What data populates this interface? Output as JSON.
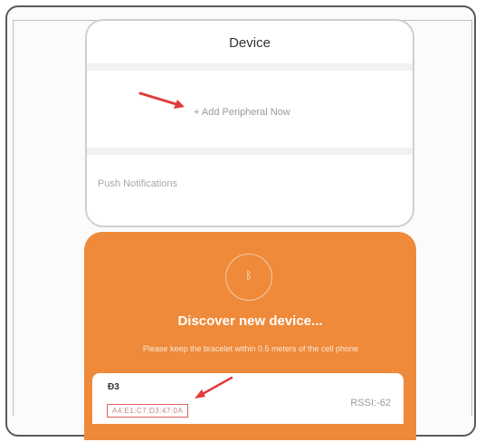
{
  "device_screen": {
    "title": "Device",
    "add_peripheral": "+ Add Peripheral Now",
    "push_notifications": "Push Notifications"
  },
  "discover_screen": {
    "title": "Discover new device...",
    "hint": "Please keep the bracelet within 0.5 meters of the cell phone",
    "bluetooth_icon": "bluetooth-icon"
  },
  "found_device": {
    "name": "Đ3",
    "mac": "A4:E1:C7:D3:47:0A",
    "rssi": "RSSI:-62"
  },
  "colors": {
    "accent_orange": "#ee8a3a",
    "annotation_red": "#e23a3a"
  }
}
